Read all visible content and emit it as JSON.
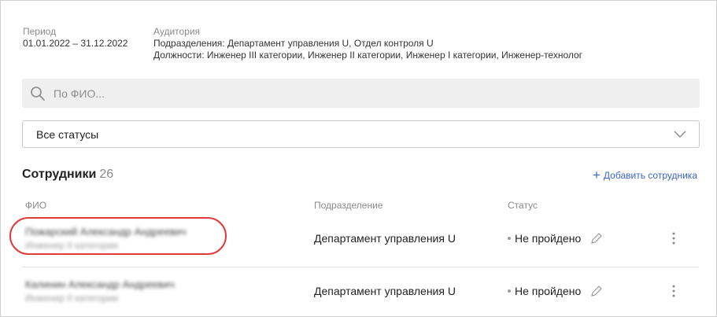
{
  "filters": {
    "period_label": "Период",
    "period_value": "01.01.2022 – 31.12.2022",
    "audience_label": "Аудитория",
    "audience_departments": "Подразделения: Департамент управления U, Отдел контроля U",
    "audience_positions": "Должности: Инженер III категории, Инженер II категории, Инженер I категории, Инженер-технолог"
  },
  "search": {
    "placeholder": "По ФИО..."
  },
  "status_filter": {
    "selected": "Все статусы"
  },
  "employees": {
    "title": "Сотрудники",
    "count": "26",
    "add_label": "Добавить сотрудника",
    "columns": {
      "name": "ФИО",
      "department": "Подразделение",
      "status": "Статус"
    },
    "rows": [
      {
        "name": "Пожарский Александр Андреевич",
        "position": "Инженер II категории",
        "department": "Департамент управления U",
        "status": "Не пройдено"
      },
      {
        "name": "Калинин Александр Андреевич",
        "position": "Инженер II категории",
        "department": "Департамент управления U",
        "status": "Не пройдено"
      }
    ]
  },
  "colors": {
    "accent": "#3a66c9",
    "highlight": "#e23a3a"
  },
  "icons": {
    "search": "search-icon",
    "dropdown": "chevron-down-icon",
    "add": "plus-icon",
    "edit": "pencil-icon",
    "more": "more-vertical-icon"
  }
}
